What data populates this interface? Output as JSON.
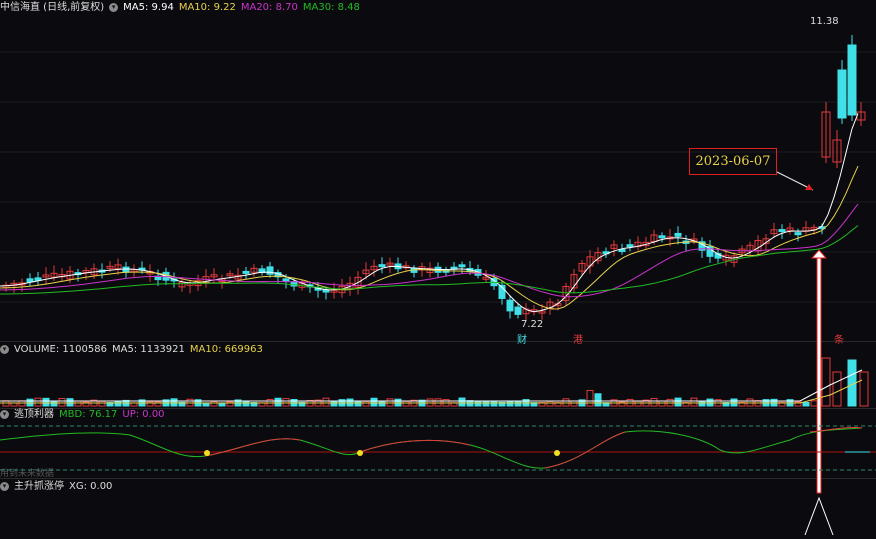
{
  "header": {
    "title": "中信海直 (日线,前复权)",
    "ma5": "MA5: 9.94",
    "ma10": "MA10: 9.22",
    "ma20": "MA20: 8.70",
    "ma30": "MA30: 8.48"
  },
  "price": {
    "high_label": "11.38",
    "low_label": "7.22",
    "date_label": "2023-06-07",
    "tags": [
      "财",
      "港",
      "条"
    ]
  },
  "volume": {
    "label": "VOLUME: 1100586",
    "ma5": "MA5: 1133921",
    "ma10": "MA10: 669963"
  },
  "escape": {
    "label": "逃顶利器",
    "mbd": "MBD: 76.17",
    "up": "UP: 0.00",
    "future_note": "用到未来数据"
  },
  "main": {
    "label": "主升抓涨停",
    "xg": "XG: 0.00"
  },
  "colors": {
    "up": "#e03a3a",
    "down": "#3fe0e8",
    "ma5": "#ffffff",
    "ma10": "#e8d24a",
    "ma20": "#cc33cc",
    "ma30": "#22bb22"
  }
}
